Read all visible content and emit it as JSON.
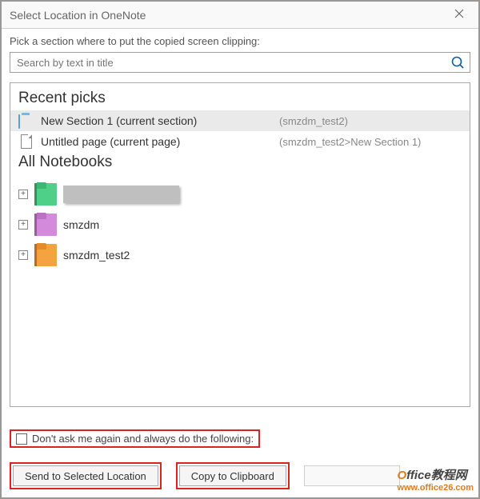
{
  "titlebar": {
    "title": "Select Location in OneNote"
  },
  "instruction": "Pick a section where to put the copied screen clipping:",
  "search": {
    "placeholder": "Search by text in title"
  },
  "panel": {
    "recent_header": "Recent picks",
    "recent": [
      {
        "icon": "section",
        "name": "New Section 1 (current section)",
        "path": "(smzdm_test2)",
        "selected": true
      },
      {
        "icon": "page",
        "name": "Untitled page (current page)",
        "path": "(smzdm_test2>New Section 1)",
        "selected": false
      }
    ],
    "notebooks_header": "All Notebooks",
    "notebooks": [
      {
        "color": "green",
        "name": "",
        "redacted": true
      },
      {
        "color": "pink",
        "name": "smzdm",
        "redacted": false
      },
      {
        "color": "orange",
        "name": "smzdm_test2",
        "redacted": false
      }
    ]
  },
  "footer": {
    "checkbox_label": "Don't ask me again and always do the following:",
    "send_button": "Send to Selected Location",
    "copy_button": "Copy to Clipboard"
  },
  "watermark": {
    "brand_prefix": "O",
    "brand_rest": "ffice教程网",
    "url": "www.office26.com"
  }
}
